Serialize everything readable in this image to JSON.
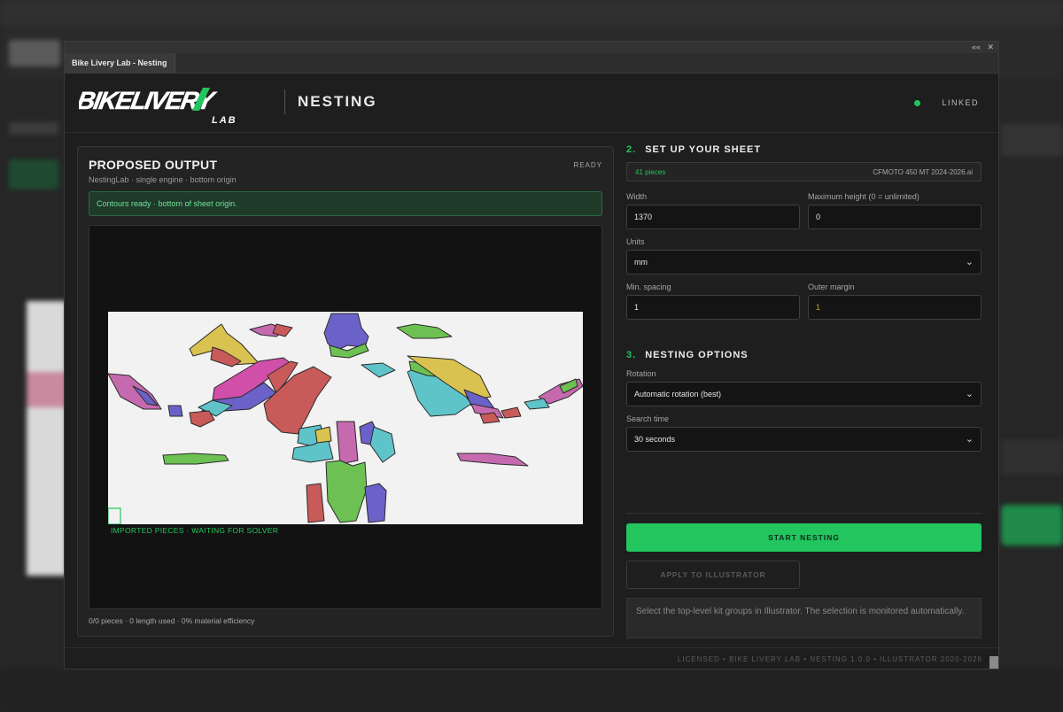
{
  "window": {
    "tab_title": "Bike Livery Lab - Nesting",
    "controls": [
      "««",
      "✕"
    ]
  },
  "header": {
    "logo_main": "BIKELIVERY",
    "logo_sub": "LAB",
    "title": "NESTING",
    "link_status": "LINKED"
  },
  "output_panel": {
    "title": "PROPOSED OUTPUT",
    "subtitle": "NestingLab · single engine · bottom origin",
    "status": "READY",
    "alert": "Contours ready · bottom of sheet origin.",
    "canvas_status": "IMPORTED PIECES · WAITING FOR SOLVER",
    "footer": "0/0 pieces · 0 length used · 0% material efficiency"
  },
  "sheet_setup": {
    "number": "2.",
    "title": "SET UP YOUR SHEET",
    "pieces_count": "41 pieces",
    "file_name": "CFMOTO 450 MT 2024-2026.ai",
    "width_label": "Width",
    "width_value": "1370",
    "max_height_label": "Maximum height (0 = unlimited)",
    "max_height_value": "0",
    "units_label": "Units",
    "units_value": "mm",
    "spacing_label": "Min. spacing",
    "spacing_value": "1",
    "margin_label": "Outer margin",
    "margin_value": "1"
  },
  "nesting_options": {
    "number": "3.",
    "title": "NESTING OPTIONS",
    "rotation_label": "Rotation",
    "rotation_value": "Automatic rotation (best)",
    "search_label": "Search time",
    "search_value": "30 seconds"
  },
  "actions": {
    "start": "START NESTING",
    "apply": "APPLY TO ILLUSTRATOR",
    "info": "Select the top-level kit groups in Illustrator. The selection is monitored automatically."
  },
  "footer": {
    "text": "LICENSED  •  BIKE LIVERY LAB  •  NESTING 1.0.0  •  ILLUSTRATOR 2020-2026"
  },
  "colors": {
    "accent": "#22c55e",
    "alert_bg": "#1f3a29",
    "panel_bg": "#232323",
    "piece_palette": [
      "#c95a5a",
      "#6a62c8",
      "#d04fa8",
      "#d9c24f",
      "#5fc4c9",
      "#6cc152",
      "#c66ab0",
      "#c25c6b"
    ]
  }
}
